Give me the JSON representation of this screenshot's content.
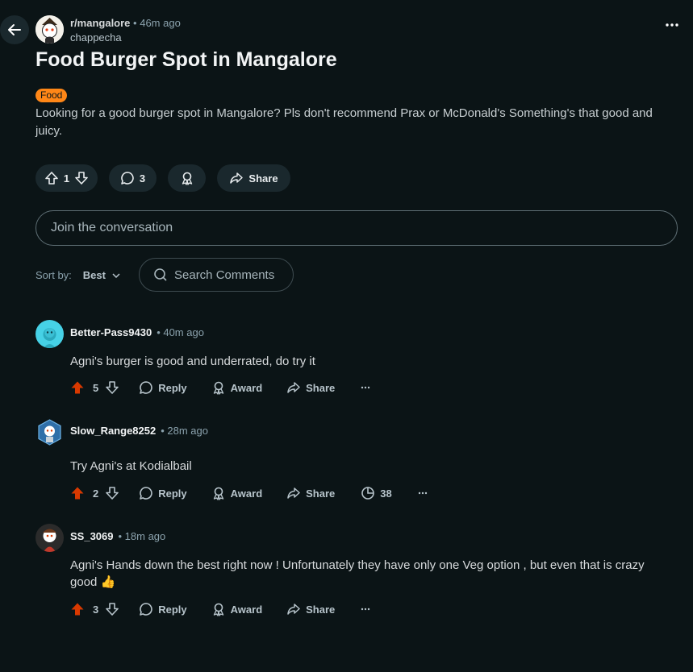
{
  "post": {
    "subreddit": "r/mangalore",
    "time": "• 46m ago",
    "author": "chappecha",
    "title": "Food Burger Spot in Mangalore",
    "flair": "Food",
    "flair_color": "#ff8717",
    "body": "Looking for a good burger spot in Mangalore? Pls don't recommend Prax or McDonald's Something's that good and juicy.",
    "votes": "1",
    "comments_count": "3",
    "share_label": "Share"
  },
  "composer": {
    "placeholder": "Join the conversation"
  },
  "sort": {
    "label": "Sort by:",
    "value": "Best"
  },
  "search": {
    "placeholder": "Search Comments"
  },
  "comments": [
    {
      "author": "Better-Pass9430",
      "time": "• 40m ago",
      "text": "Agni's burger is good and underrated, do try it",
      "votes": "5",
      "reply": "Reply",
      "award": "Award",
      "share": "Share"
    },
    {
      "author": "Slow_Range8252",
      "time": "• 28m ago",
      "text": "Try Agni's at Kodialbail",
      "votes": "2",
      "reply": "Reply",
      "award": "Award",
      "share": "Share",
      "insights": "38"
    },
    {
      "author": "SS_3069",
      "time": "• 18m ago",
      "text": "Agni's Hands down the best right now ! Unfortunately they have only one Veg option , but even that is crazy good 👍",
      "votes": "3",
      "reply": "Reply",
      "award": "Award",
      "share": "Share"
    }
  ],
  "colors": {
    "upvote_active": "#d93900",
    "background": "#0b1416",
    "pill": "#1a282d"
  }
}
